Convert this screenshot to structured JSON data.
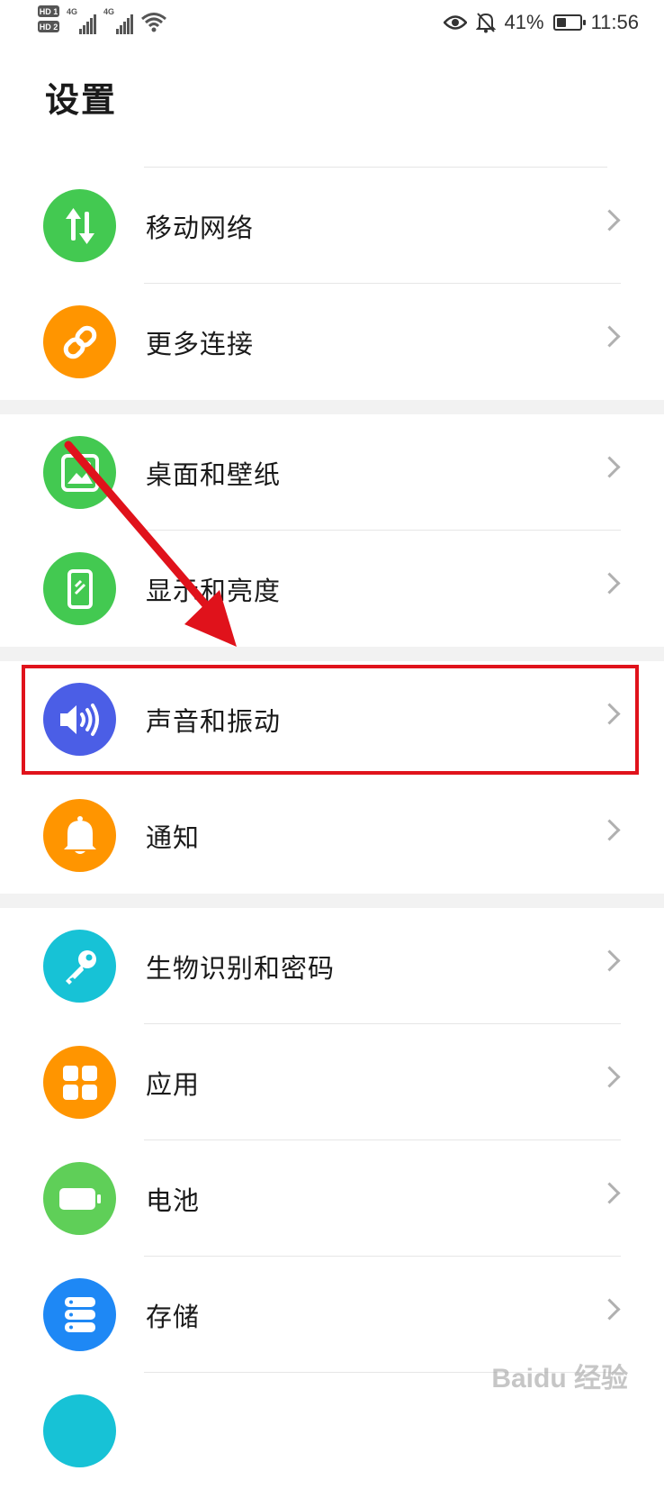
{
  "status_bar": {
    "hd1": "HD 1",
    "hd2": "HD 2",
    "net1": "4G",
    "net2": "4G",
    "battery_pct": "41%",
    "battery_level": 0.41,
    "time": "11:56"
  },
  "page_title": "设置",
  "groups": [
    {
      "items": [
        {
          "label": "移动网络",
          "icon": "mobile-data-icon",
          "color": "#43c951"
        },
        {
          "label": "更多连接",
          "icon": "link-icon",
          "color": "#ff9500"
        }
      ]
    },
    {
      "items": [
        {
          "label": "桌面和壁纸",
          "icon": "wallpaper-icon",
          "color": "#43c951"
        },
        {
          "label": "显示和亮度",
          "icon": "display-icon",
          "color": "#43c951"
        }
      ]
    },
    {
      "items": [
        {
          "label": "声音和振动",
          "icon": "sound-icon",
          "color": "#4b5ee6"
        },
        {
          "label": "通知",
          "icon": "bell-icon",
          "color": "#ff9500"
        }
      ]
    },
    {
      "items": [
        {
          "label": "生物识别和密码",
          "icon": "key-icon",
          "color": "#17c2d6"
        },
        {
          "label": "应用",
          "icon": "apps-icon",
          "color": "#ff9500"
        },
        {
          "label": "电池",
          "icon": "battery-icon",
          "color": "#5fcf58"
        },
        {
          "label": "存储",
          "icon": "storage-icon",
          "color": "#1e88f5"
        }
      ]
    }
  ],
  "annotation": {
    "color": "#e0121b"
  },
  "watermark": "Baidu 经验"
}
